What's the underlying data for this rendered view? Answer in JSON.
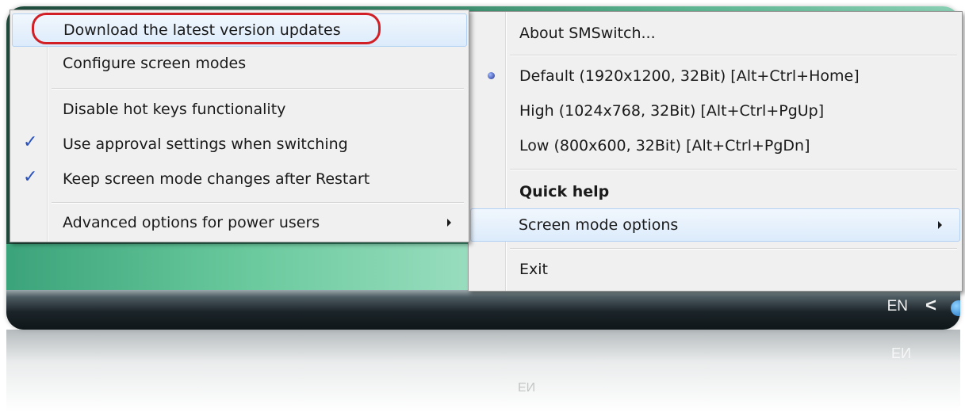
{
  "taskbar": {
    "language": "EN",
    "chevron": "<",
    "reflection_text": "EN"
  },
  "left_menu": {
    "items": [
      {
        "label": "Download the latest version updates",
        "highlighted": true
      },
      {
        "label": "Configure screen modes"
      },
      {
        "label": "Disable hot keys functionality"
      },
      {
        "label": "Use approval settings when switching",
        "checked": true
      },
      {
        "label": "Keep screen mode changes after Restart",
        "checked": true
      },
      {
        "label": "Advanced options for power users",
        "submenu": true
      }
    ],
    "check_glyph": "✓"
  },
  "right_menu": {
    "items": [
      {
        "label": "About SMSwitch..."
      },
      {
        "label": "Default  (1920x1200, 32Bit)  [Alt+Ctrl+Home]",
        "selected": true
      },
      {
        "label": "High  (1024x768, 32Bit)  [Alt+Ctrl+PgUp]"
      },
      {
        "label": "Low  (800x600, 32Bit)  [Alt+Ctrl+PgDn]"
      },
      {
        "label": "Quick help",
        "bold": true
      },
      {
        "label": "Screen mode options",
        "submenu": true,
        "highlighted": true
      },
      {
        "label": "Exit"
      }
    ]
  },
  "colors": {
    "annotation": "#d21f26",
    "check": "#2a52be",
    "highlight": "#dcebfb"
  }
}
